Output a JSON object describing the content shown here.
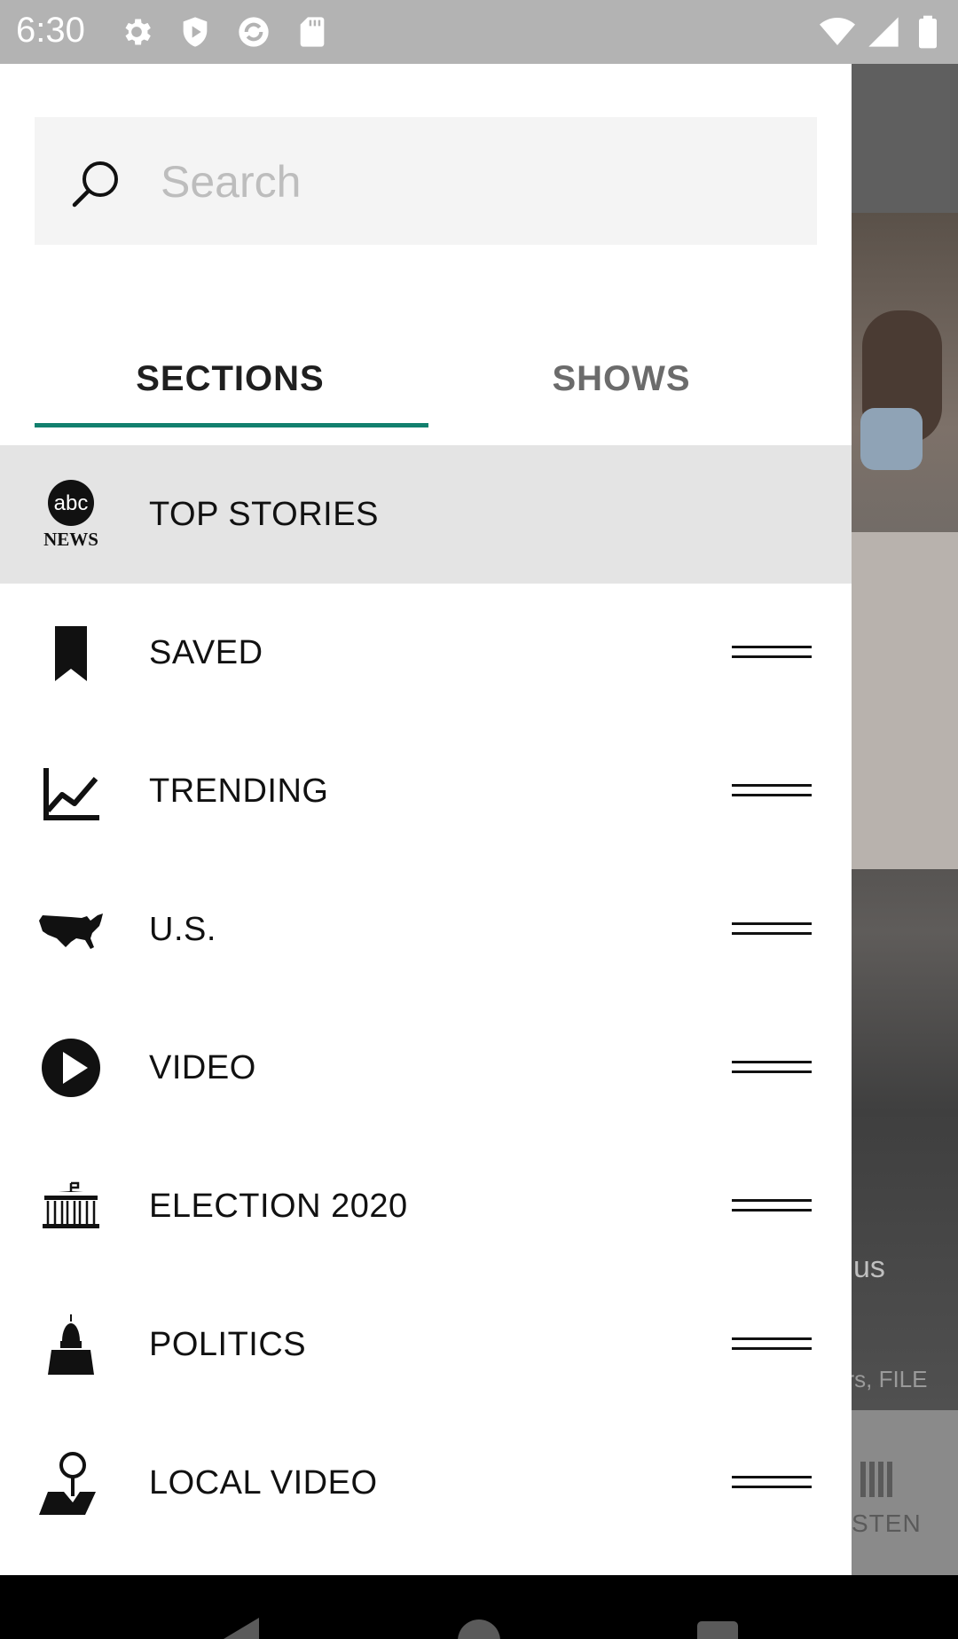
{
  "status_bar": {
    "time": "6:30",
    "left_icons": [
      "settings-icon",
      "shield-icon",
      "sync-icon",
      "sd-card-icon"
    ],
    "right_icons": [
      "wifi-icon",
      "cell-signal-icon",
      "battery-icon"
    ]
  },
  "search": {
    "placeholder": "Search",
    "value": ""
  },
  "tabs": [
    {
      "label": "SECTIONS",
      "selected": true
    },
    {
      "label": "SHOWS",
      "selected": false
    }
  ],
  "accent_color": "#12806e",
  "menu": {
    "items": [
      {
        "label": "TOP STORIES",
        "icon": "abc-news-logo",
        "active": true,
        "draggable": false
      },
      {
        "label": "SAVED",
        "icon": "bookmark-icon",
        "active": false,
        "draggable": true
      },
      {
        "label": "TRENDING",
        "icon": "trending-chart-icon",
        "active": false,
        "draggable": true
      },
      {
        "label": "U.S.",
        "icon": "us-map-icon",
        "active": false,
        "draggable": true
      },
      {
        "label": "VIDEO",
        "icon": "play-icon",
        "active": false,
        "draggable": true
      },
      {
        "label": "ELECTION 2020",
        "icon": "white-house-icon",
        "active": false,
        "draggable": true
      },
      {
        "label": "POLITICS",
        "icon": "capitol-icon",
        "active": false,
        "draggable": true
      },
      {
        "label": "LOCAL VIDEO",
        "icon": "map-pin-icon",
        "active": false,
        "draggable": true
      }
    ]
  },
  "logo_text": {
    "abc": "abc",
    "news": "NEWS"
  },
  "background_peek": {
    "headline_fragment": "us",
    "caption_fragment": "ers, FILE",
    "tab_fragment": "STEN"
  }
}
